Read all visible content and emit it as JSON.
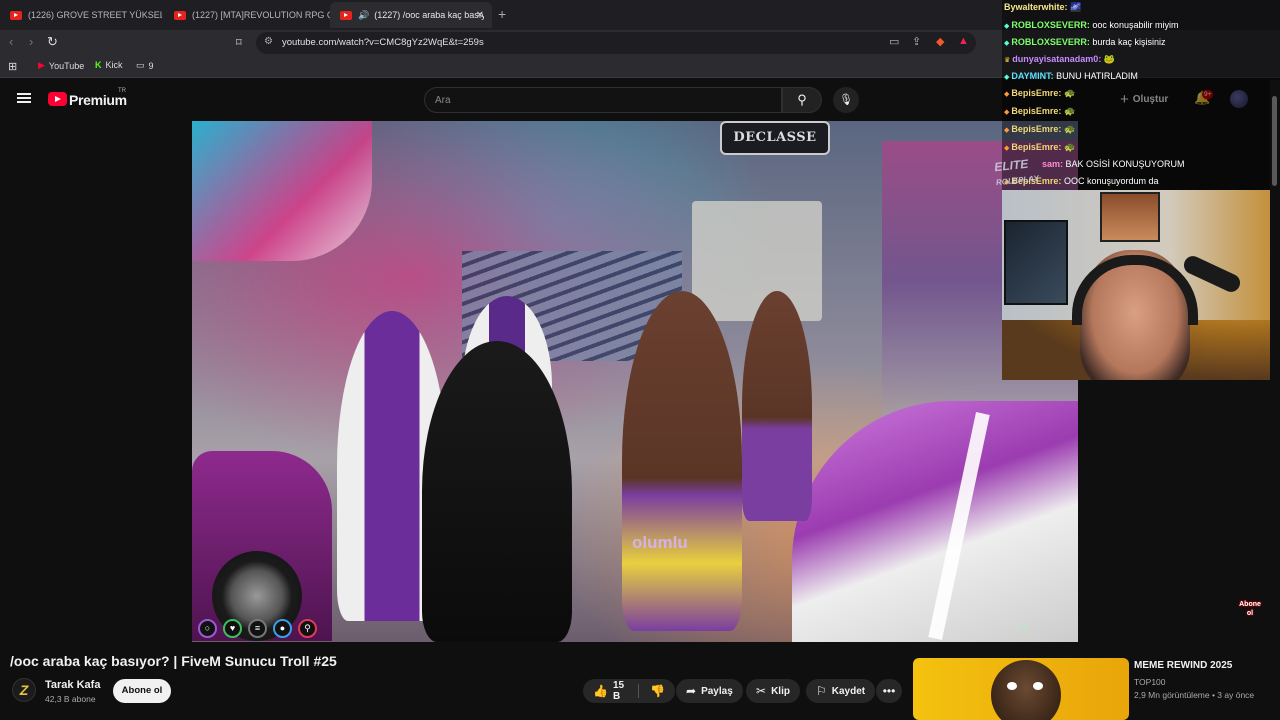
{
  "tabs": [
    {
      "label": "(1226) GROVE STREET YÜKSELİYOR"
    },
    {
      "label": "(1227) [MTA]REVOLUTION RPG ÇETE"
    },
    {
      "label": "(1227) /ooc araba kaç basıyor",
      "audio": true
    }
  ],
  "address_bar": {
    "url": "youtube.com/watch?v=CMC8gYz2WqE&t=259s"
  },
  "bookmarks": [
    {
      "label": "YouTube"
    },
    {
      "label": "Kick"
    },
    {
      "label": "9"
    }
  ],
  "header": {
    "brand": "Premium",
    "region": "TR",
    "search_placeholder": "Ara",
    "create_label": "Oluştur",
    "notification_count": "9+"
  },
  "video": {
    "sign": "DECLASSE",
    "overlay_text": "olumlu",
    "hud_icons": [
      "circle-icon",
      "heart-icon",
      "food-icon",
      "water-icon",
      "run-icon"
    ]
  },
  "chat": [
    {
      "user": "Bywalterwhite:",
      "text": "",
      "color": "#f3e98b"
    },
    {
      "user": "ROBLOXSEVERR:",
      "text": "ooc konuşabilir miyim",
      "color": "#7dff6a"
    },
    {
      "user": "ROBLOXSEVERR:",
      "text": "burda kaç kişisiniz",
      "color": "#7dff6a"
    },
    {
      "user": "dunyayisatanadam0:",
      "text": "",
      "color": "#c78bff"
    },
    {
      "user": "DAYMINT:",
      "text": "BUNU HATIRLADIM",
      "color": "#5be3ff"
    },
    {
      "user": "BepisEmre:",
      "text": "",
      "color": "#f0d77a"
    },
    {
      "user": "BepisEmre:",
      "text": "",
      "color": "#f0d77a"
    },
    {
      "user": "BepisEmre:",
      "text": "",
      "color": "#f0d77a"
    },
    {
      "user": "BepisEmre:",
      "text": "",
      "color": "#f0d77a"
    },
    {
      "user": "sam:",
      "text": "BAK OSİSİ KONUŞUYORUM",
      "color": "#ff8ad2"
    },
    {
      "user": "BepisEmre:",
      "text": "OOC konuşuyordum da",
      "color": "#f0d77a"
    }
  ],
  "stream_watermark": "ELITE",
  "stream_watermark_sub": "ROLEPLAY",
  "subscribe_sticker": "Abone ol",
  "watch": {
    "title": "/ooc araba kaç basıyor? | FiveM Sunucu Troll #25",
    "channel_name": "Tarak Kafa",
    "subscriber_count": "42,3 B abone",
    "subscribe_label": "Abone ol",
    "like_count": "15 B",
    "share_label": "Paylaş",
    "clip_label": "Klip",
    "save_label": "Kaydet"
  },
  "recommended": {
    "title": "MEME REWIND 2025",
    "channel": "TOP100",
    "meta": "2,9 Mn görüntüleme • 3 ay önce"
  }
}
